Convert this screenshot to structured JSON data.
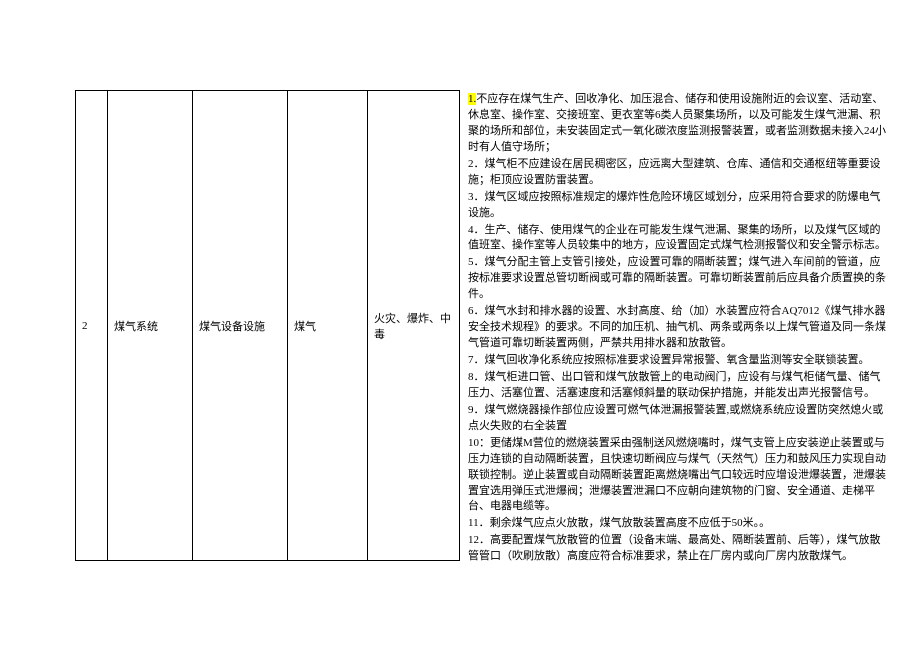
{
  "table": {
    "row": {
      "index": "2",
      "system": "煤气系统",
      "equipment": "煤气设备设施",
      "hazard": "煤气",
      "risk": "火灾、爆炸、中毒"
    }
  },
  "content": {
    "p1_hl": "1.",
    "p1_rest": "不应存在煤气生产、回收净化、加压混合、储存和使用设施附近的会议室、活动室、休息室、操作室、交接班室、更衣室等6类人员聚集场所，以及可能发生煤气泄漏、积聚的场所和部位，未安装固定式一氧化碳浓度监测报警装置，或者监测数据未接入24小时有人值守场所；",
    "p2": "2．煤气柜不应建设在居民稠密区，应远离大型建筑、仓库、通信和交通枢纽等重要设施；柜顶应设置防雷装置。",
    "p3": "3．煤气区域应按照标准规定的爆炸性危险环境区域划分，应采用符合要求的防爆电气设施。",
    "p4": "4．生产、储存、使用煤气的企业在可能发生煤气泄漏、聚集的场所，以及煤气区域的值班室、操作室等人员较集中的地方，应设置固定式煤气检测报警仪和安全警示标志。",
    "p5": "5．煤气分配主管上支管引接处，应设置可靠的隔断装置；煤气进入车间前的管道，应按标准要求设置总管切断阀或可靠的隔断装置。可靠切断装置前后应具备介质置换的条件。",
    "p6": "6．煤气水封和排水器的设置、水封高度、给（加）水装置应符合AQ7012《煤气排水器安全技术规程》的要求。不同的加压机、抽气机、两条或两条以上煤气管道及同一条煤气管道可靠切断装置两侧，严禁共用排水器和放散管。",
    "p7": "7．煤气回收净化系统应按照标准要求设置异常报警、氧含量监测等安全联锁装置。",
    "p8": "8．煤气柜进口管、出口管和煤气放散管上的电动阀门，应设有与煤气柜储气量、储气压力、活塞位置、活塞速度和活塞倾斜量的联动保护措施，并能发出声光报警信号。",
    "p9": "9．煤气燃烧器操作部位应设置可燃气体泄漏报警装置,或燃烧系统应设置防突然熄火或点火失败的右全装置",
    "p10": "10：更储煤M营位的燃烧装置采由强制送风燃烧嘴时，煤气支管上应安装逆止装置或与压力连锁的自动隔断装置，且快速切断阀应与煤气（天然气）压力和鼓风压力实现自动联锁控制。逆止装置或自动隔断装置距离燃烧嘴出气口较远时应增设泄爆装置，泄爆装置宜选用弹压式泄爆阀；泄爆装置泄漏口不应朝向建筑物的门窗、安全通道、走梯平台、电器电缆等。",
    "p11": "11．剩余煤气应点火放散，煤气放散装置高度不应低于50米。。",
    "p12": "12．高要配置煤气放散管的位置（设备末端、最高处、隔断装置前、后等），煤气放散管管口（吹刷放散）高度应符合标准要求，禁止在厂房内或向厂房内放散煤气。"
  }
}
